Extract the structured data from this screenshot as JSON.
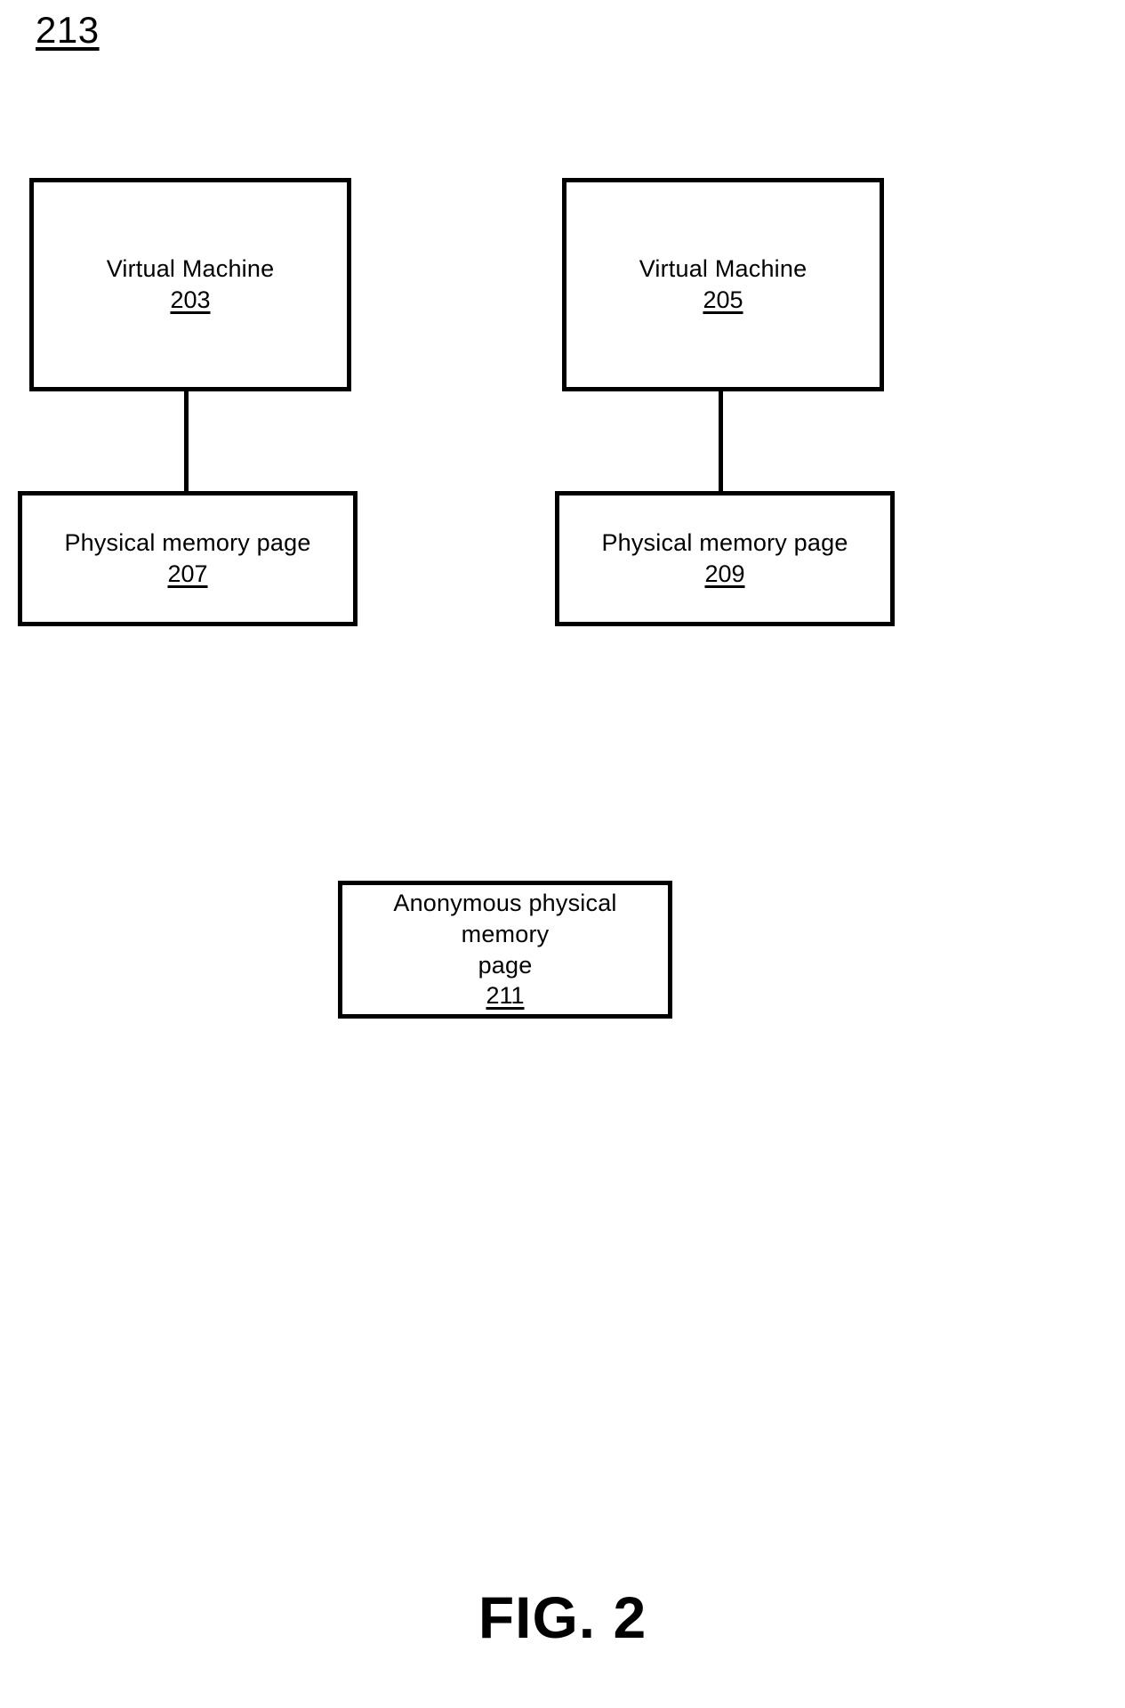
{
  "figure": {
    "reference_numeral": "213",
    "caption": "FIG. 2"
  },
  "boxes": {
    "virtual_machine_left": {
      "label": "Virtual Machine",
      "number": "203"
    },
    "virtual_machine_right": {
      "label": "Virtual Machine",
      "number": "205"
    },
    "physical_memory_page_left": {
      "label": "Physical memory page",
      "number": "207"
    },
    "physical_memory_page_right": {
      "label": "Physical memory page",
      "number": "209"
    },
    "anonymous_physical_memory_page": {
      "label": "Anonymous physical memory\npage",
      "number": "211"
    }
  },
  "colors": {
    "stroke": "#000000",
    "background": "#ffffff"
  }
}
